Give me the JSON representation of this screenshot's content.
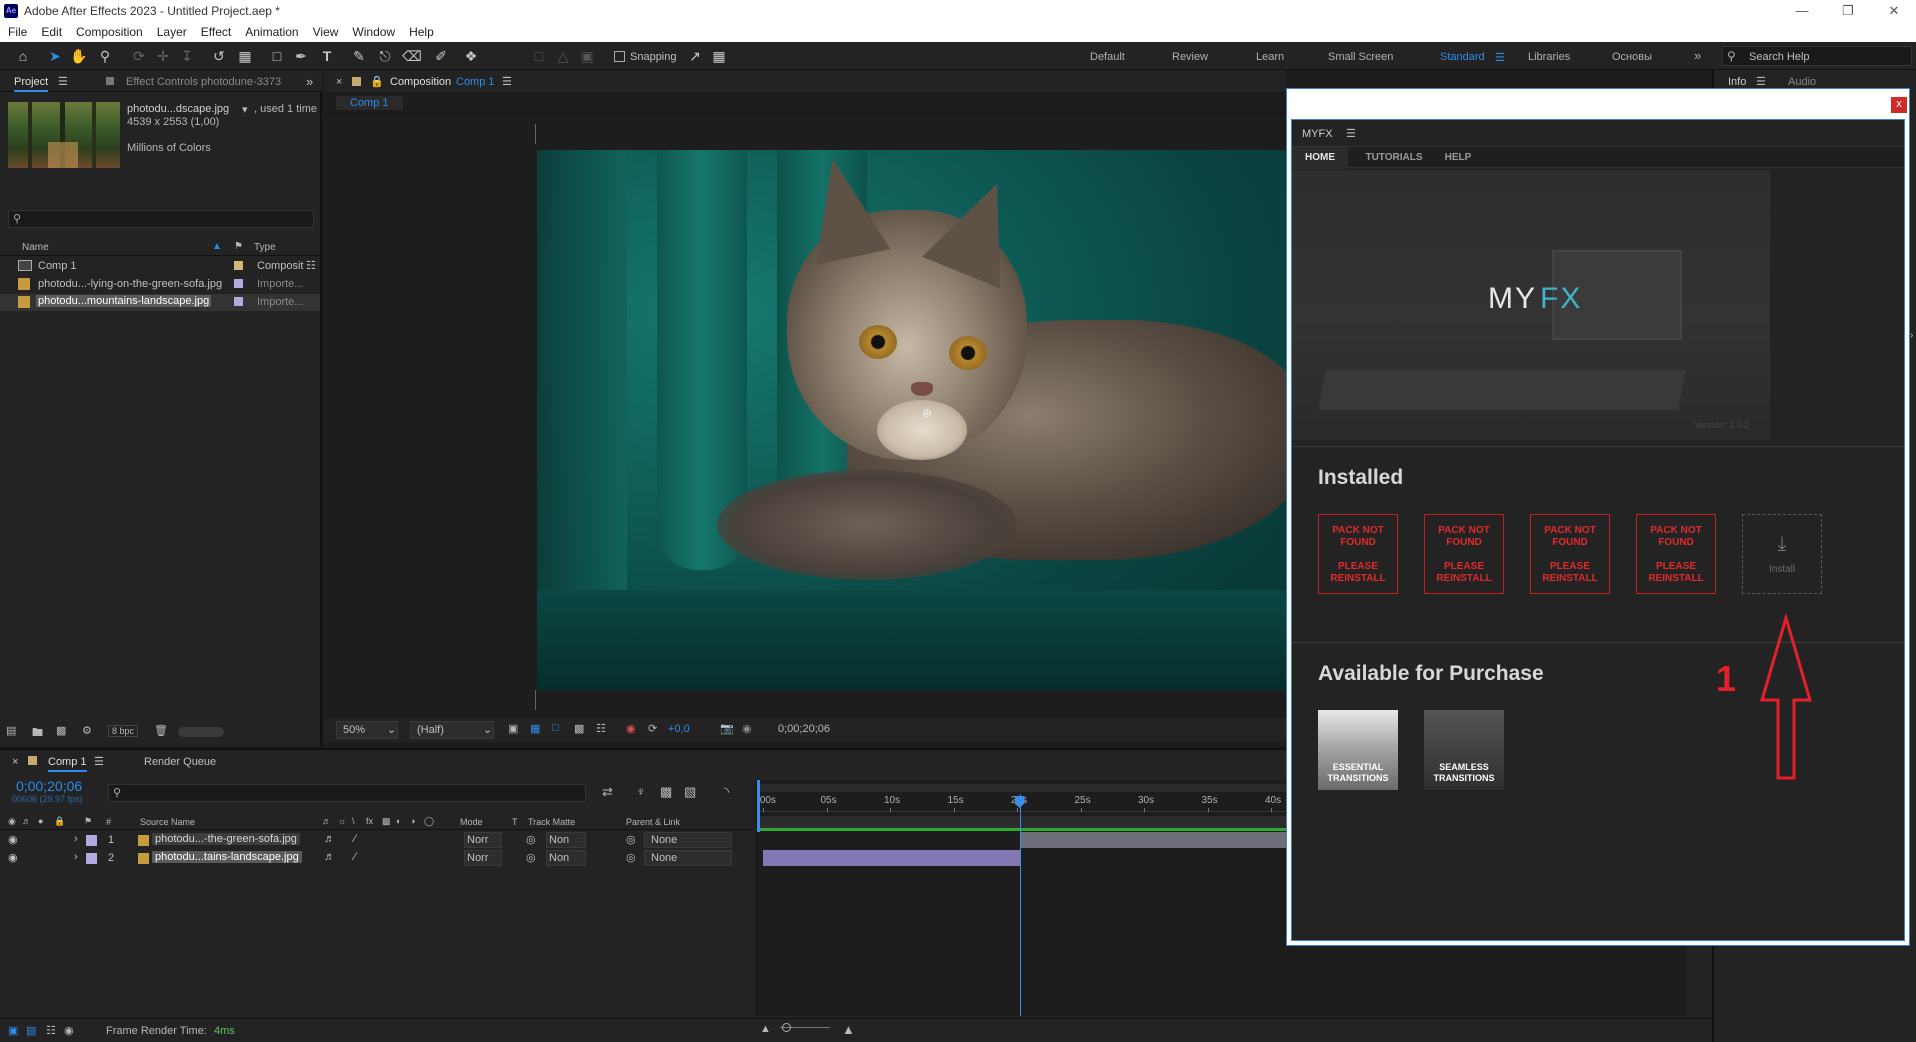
{
  "window": {
    "title": "Adobe After Effects 2023 - Untitled Project.aep *",
    "app_icon": "Ae",
    "controls": [
      "minimize-icon",
      "restore-icon",
      "close-icon"
    ]
  },
  "menu": [
    "File",
    "Edit",
    "Composition",
    "Layer",
    "Effect",
    "Animation",
    "View",
    "Window",
    "Help"
  ],
  "toolbar": {
    "snapping_label": "Snapping",
    "workspaces": [
      "Default",
      "Review",
      "Learn",
      "Small Screen",
      "Standard",
      "Libraries",
      "Основы"
    ],
    "active_workspace": "Standard",
    "search_placeholder": "Search Help"
  },
  "project_panel": {
    "tab_project": "Project",
    "tab_effect_controls": "Effect Controls photodune-3373",
    "preview": {
      "filename": "photodu...dscape.jpg",
      "used": ", used 1 time",
      "dimensions": "4539 x 2553 (1,00)",
      "colors": "Millions of Colors"
    },
    "col_name": "Name",
    "col_type": "Type",
    "items": [
      {
        "name": "Comp 1",
        "type": "Composit",
        "selected": false
      },
      {
        "name": "photodu...-lying-on-the-green-sofa.jpg",
        "type": "Importe...",
        "selected": false
      },
      {
        "name": "photodu...mountains-landscape.jpg",
        "type": "Importe...",
        "selected": true
      }
    ],
    "bpc": "8 bpc"
  },
  "composition_panel": {
    "tab_prefix": "Composition",
    "tab_name": "Comp 1",
    "breadcrumb": "Comp 1",
    "zoom": "50%",
    "resolution": "(Half)",
    "exposure": "+0,0",
    "timecode": "0;00;20;06"
  },
  "info_panel": {
    "tab_info": "Info",
    "tab_audio": "Audio"
  },
  "myfx": {
    "header": "MYFX",
    "tabs": [
      "HOME",
      "TUTORIALS",
      "HELP"
    ],
    "active_tab": "HOME",
    "logo_my": "MY",
    "logo_fx": "FX",
    "version": "Version: 1.0.2",
    "installed_heading": "Installed",
    "not_found_line1": "PACK NOT FOUND",
    "not_found_line2": "PLEASE REINSTALL",
    "install_label": "Install",
    "purchase_heading": "Available for Purchase",
    "purchase_items": [
      "ESSENTIAL TRANSITIONS",
      "SEAMLESS TRANSITIONS"
    ],
    "close_label": "x"
  },
  "annotation": {
    "label": "1",
    "color": "#e4202a"
  },
  "timeline": {
    "tab_comp": "Comp 1",
    "tab_render": "Render Queue",
    "timecode": "0;00;20;06",
    "frame_info": "00606 (29.97 fps)",
    "columns": {
      "num": "#",
      "source_name": "Source Name",
      "mode": "Mode",
      "t": "T",
      "track_matte": "Track Matte",
      "parent": "Parent & Link"
    },
    "ruler": [
      "0s",
      "05s",
      "10s",
      "15s",
      "20s",
      "25s",
      "30s",
      "35s",
      "40s"
    ],
    "ruler_first": ":00s",
    "playhead_seconds": 20.2,
    "layers": [
      {
        "num": "1",
        "name": "photodu...-the-green-sofa.jpg",
        "mode": "Norr",
        "matte": "Non",
        "parent": "None"
      },
      {
        "num": "2",
        "name": "photodu...tains-landscape.jpg",
        "mode": "Norr",
        "matte": "Non",
        "parent": "None"
      }
    ]
  },
  "status": {
    "frame_render_label": "Frame Render Time:",
    "frame_render_value": "4ms"
  }
}
